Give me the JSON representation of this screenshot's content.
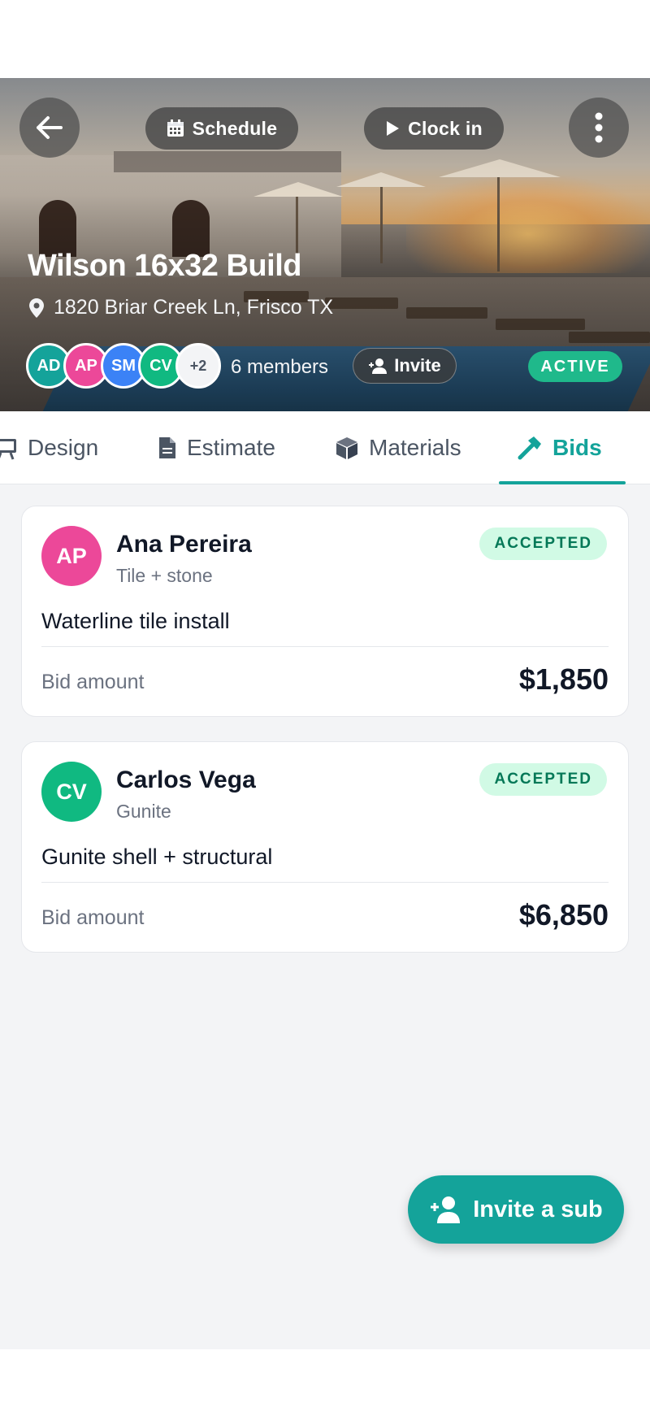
{
  "header": {
    "schedule_label": "Schedule",
    "clock_in_label": "Clock in",
    "project_title": "Wilson 16x32 Build",
    "address": "1820 Briar Creek Ln, Frisco TX",
    "members": [
      {
        "initials": "AD",
        "color": "#14a39a"
      },
      {
        "initials": "AP",
        "color": "#ec4899"
      },
      {
        "initials": "SM",
        "color": "#3b82f6"
      },
      {
        "initials": "CV",
        "color": "#10b981"
      }
    ],
    "more_members": "+2",
    "members_count": "6 members",
    "invite_label": "Invite",
    "status": "ACTIVE"
  },
  "tabs": [
    {
      "label": "Design",
      "icon": "easel-icon"
    },
    {
      "label": "Estimate",
      "icon": "document-icon"
    },
    {
      "label": "Materials",
      "icon": "cube-icon"
    },
    {
      "label": "Bids",
      "icon": "hammer-icon",
      "active": true
    }
  ],
  "bids": [
    {
      "initials": "AP",
      "avatar_color": "#ec4899",
      "name": "Ana Pereira",
      "trade": "Tile + stone",
      "status": "ACCEPTED",
      "description": "Waterline tile install",
      "amount_label": "Bid amount",
      "amount": "$1,850"
    },
    {
      "initials": "CV",
      "avatar_color": "#10b981",
      "name": "Carlos Vega",
      "trade": "Gunite",
      "status": "ACCEPTED",
      "description": "Gunite shell + structural",
      "amount_label": "Bid amount",
      "amount": "$6,850"
    }
  ],
  "fab": {
    "label": "Invite a sub",
    "icon": "add-person-icon"
  },
  "colors": {
    "accent": "#14a39a",
    "active_badge": "#1fb98b",
    "accepted_bg": "#d1fae5",
    "accepted_text": "#047857"
  }
}
